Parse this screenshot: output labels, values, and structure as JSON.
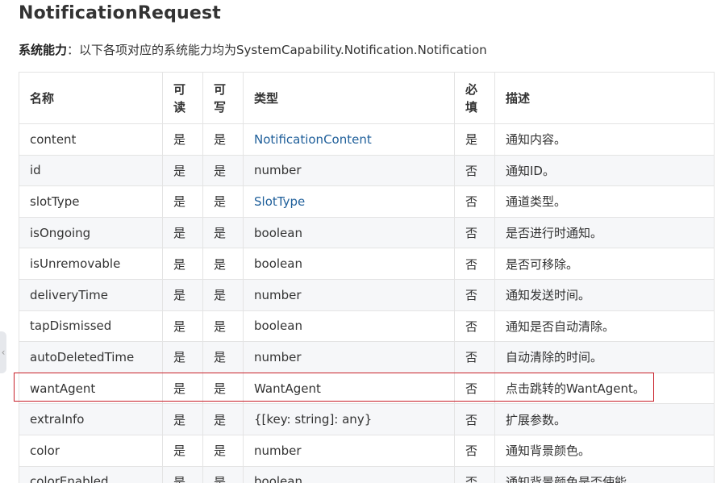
{
  "title": "NotificationRequest",
  "capability": {
    "label": "系统能力",
    "separator": "：",
    "text": "以下各项对应的系统能力均为SystemCapability.Notification.Notification"
  },
  "table": {
    "headers": {
      "name": "名称",
      "readable_line1": "可",
      "readable_line2": "读",
      "writable_line1": "可",
      "writable_line2": "写",
      "type": "类型",
      "required_line1": "必",
      "required_line2": "填",
      "desc": "描述"
    },
    "rows": [
      {
        "name": "content",
        "readable": "是",
        "writable": "是",
        "type": "NotificationContent",
        "type_is_link": true,
        "required": "是",
        "desc": "通知内容。"
      },
      {
        "name": "id",
        "readable": "是",
        "writable": "是",
        "type": "number",
        "type_is_link": false,
        "required": "否",
        "desc": "通知ID。"
      },
      {
        "name": "slotType",
        "readable": "是",
        "writable": "是",
        "type": "SlotType",
        "type_is_link": true,
        "required": "否",
        "desc": "通道类型。"
      },
      {
        "name": "isOngoing",
        "readable": "是",
        "writable": "是",
        "type": "boolean",
        "type_is_link": false,
        "required": "否",
        "desc": "是否进行时通知。"
      },
      {
        "name": "isUnremovable",
        "readable": "是",
        "writable": "是",
        "type": "boolean",
        "type_is_link": false,
        "required": "否",
        "desc": "是否可移除。"
      },
      {
        "name": "deliveryTime",
        "readable": "是",
        "writable": "是",
        "type": "number",
        "type_is_link": false,
        "required": "否",
        "desc": "通知发送时间。"
      },
      {
        "name": "tapDismissed",
        "readable": "是",
        "writable": "是",
        "type": "boolean",
        "type_is_link": false,
        "required": "否",
        "desc": "通知是否自动清除。"
      },
      {
        "name": "autoDeletedTime",
        "readable": "是",
        "writable": "是",
        "type": "number",
        "type_is_link": false,
        "required": "否",
        "desc": "自动清除的时间。"
      },
      {
        "name": "wantAgent",
        "readable": "是",
        "writable": "是",
        "type": "WantAgent",
        "type_is_link": false,
        "required": "否",
        "desc": "点击跳转的WantAgent。"
      },
      {
        "name": "extraInfo",
        "readable": "是",
        "writable": "是",
        "type": "{[key: string]: any}",
        "type_is_link": false,
        "required": "否",
        "desc": "扩展参数。"
      },
      {
        "name": "color",
        "readable": "是",
        "writable": "是",
        "type": "number",
        "type_is_link": false,
        "required": "否",
        "desc": "通知背景颜色。"
      },
      {
        "name": "colorEnabled",
        "readable": "是",
        "writable": "是",
        "type": "boolean",
        "type_is_link": false,
        "required": "否",
        "desc": "通知背景颜色是否使能。"
      }
    ]
  },
  "icons": {
    "side_tab": "chevron-left-icon"
  },
  "colors": {
    "link": "#1f5f9a",
    "highlight": "#c8202a"
  }
}
